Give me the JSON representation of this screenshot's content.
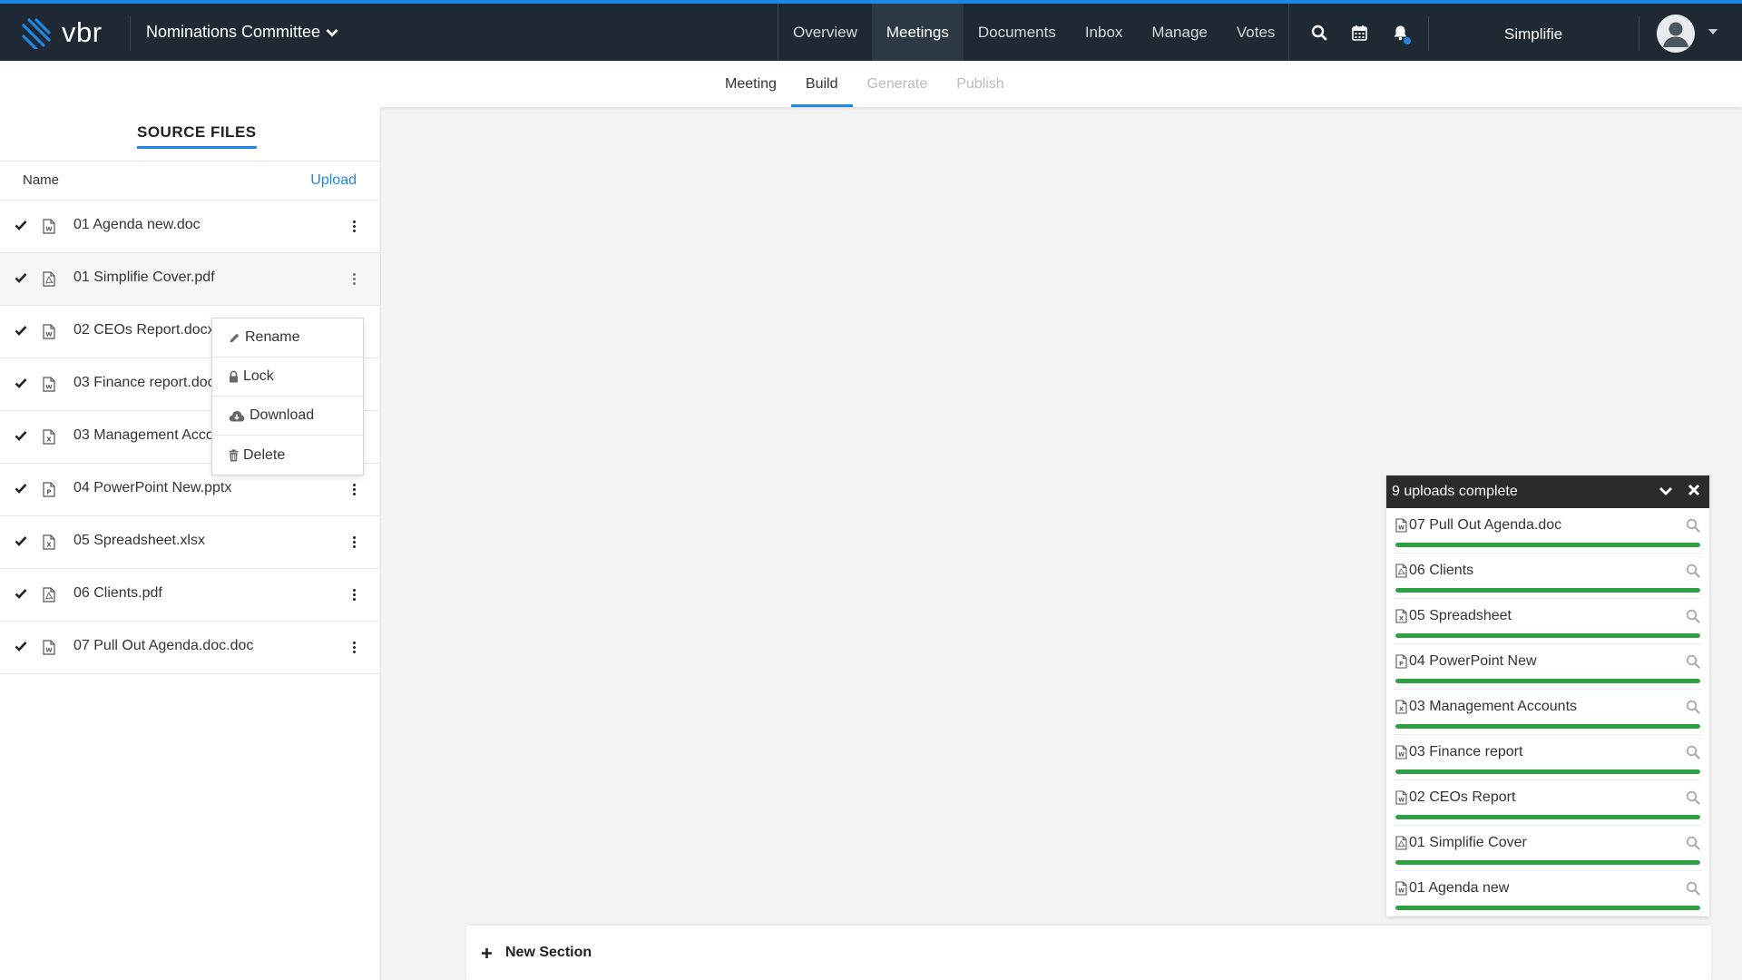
{
  "brand": {
    "name": "vbr",
    "accent": "#1e88e5"
  },
  "committee": {
    "label": "Nominations Committee"
  },
  "nav": {
    "items": [
      {
        "label": "Overview",
        "active": false
      },
      {
        "label": "Meetings",
        "active": true
      },
      {
        "label": "Documents",
        "active": false
      },
      {
        "label": "Inbox",
        "active": false
      },
      {
        "label": "Manage",
        "active": false
      },
      {
        "label": "Votes",
        "active": false
      }
    ],
    "icons": [
      "search-icon",
      "calendar-icon",
      "bell-icon"
    ]
  },
  "org": {
    "name": "Simplifie"
  },
  "subtabs": [
    {
      "label": "Meeting",
      "state": "normal"
    },
    {
      "label": "Build",
      "state": "active"
    },
    {
      "label": "Generate",
      "state": "disabled"
    },
    {
      "label": "Publish",
      "state": "disabled"
    }
  ],
  "source_files": {
    "title": "SOURCE FILES",
    "col_name": "Name",
    "upload_label": "Upload",
    "files": [
      {
        "name": "01 Agenda new.doc",
        "type": "word"
      },
      {
        "name": "01 Simplifie Cover.pdf",
        "type": "pdf"
      },
      {
        "name": "02 CEOs Report.docx",
        "type": "word"
      },
      {
        "name": "03 Finance report.docx",
        "type": "word"
      },
      {
        "name": "03 Management Accounts.xlsx",
        "type": "excel"
      },
      {
        "name": "04 PowerPoint New.pptx",
        "type": "powerpoint"
      },
      {
        "name": "05 Spreadsheet.xlsx",
        "type": "excel"
      },
      {
        "name": "06 Clients.pdf",
        "type": "pdf"
      },
      {
        "name": "07 Pull Out Agenda.doc.doc",
        "type": "word"
      }
    ]
  },
  "context_menu": {
    "items": [
      {
        "label": "Rename",
        "icon": "pencil-icon"
      },
      {
        "label": "Lock",
        "icon": "lock-icon"
      },
      {
        "label": "Download",
        "icon": "cloud-download-icon"
      },
      {
        "label": "Delete",
        "icon": "trash-icon"
      }
    ]
  },
  "uploads": {
    "title": "9 uploads complete",
    "items": [
      {
        "name": "07 Pull Out Agenda.doc",
        "type": "word",
        "progress": 100
      },
      {
        "name": "06 Clients",
        "type": "pdf",
        "progress": 100
      },
      {
        "name": "05 Spreadsheet",
        "type": "excel",
        "progress": 100
      },
      {
        "name": "04 PowerPoint New",
        "type": "powerpoint",
        "progress": 100
      },
      {
        "name": "03 Management Accounts",
        "type": "excel",
        "progress": 100
      },
      {
        "name": "03 Finance report",
        "type": "word",
        "progress": 100
      },
      {
        "name": "02 CEOs Report",
        "type": "word",
        "progress": 100
      },
      {
        "name": "01 Simplifie Cover",
        "type": "pdf",
        "progress": 100
      },
      {
        "name": "01 Agenda new",
        "type": "word",
        "progress": 100
      }
    ]
  },
  "new_section": {
    "label": "New Section"
  },
  "colors": {
    "navbar": "#1f2933",
    "progress": "#2ea043",
    "link": "#1e88e5"
  }
}
